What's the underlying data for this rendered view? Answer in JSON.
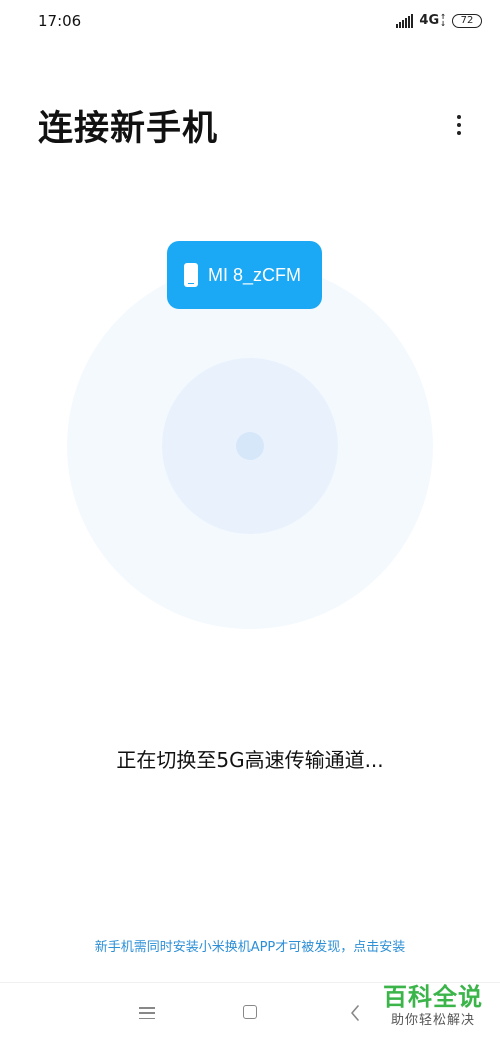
{
  "status_bar": {
    "time": "17:06",
    "network": "4G",
    "battery": "72"
  },
  "header": {
    "title": "连接新手机",
    "more_icon": "more-vertical-icon"
  },
  "device": {
    "name": "MI 8_zCFM",
    "icon": "phone-icon"
  },
  "status_message": "正在切换至5G高速传输通道...",
  "install_hint": "新手机需同时安装小米换机APP才可被发现，点击安装",
  "nav": {
    "menu_icon": "menu-icon",
    "home_icon": "home-icon",
    "back_icon": "back-icon"
  },
  "watermark": {
    "title": "百科全说",
    "subtitle": "助你轻松解决"
  },
  "colors": {
    "accent": "#1ba9f5",
    "link": "#2d8fd6",
    "radar_outer": "#f4f9fe",
    "radar_middle": "#e9f2fc",
    "radar_center": "#d6e7fa",
    "watermark": "#3bb54a"
  }
}
